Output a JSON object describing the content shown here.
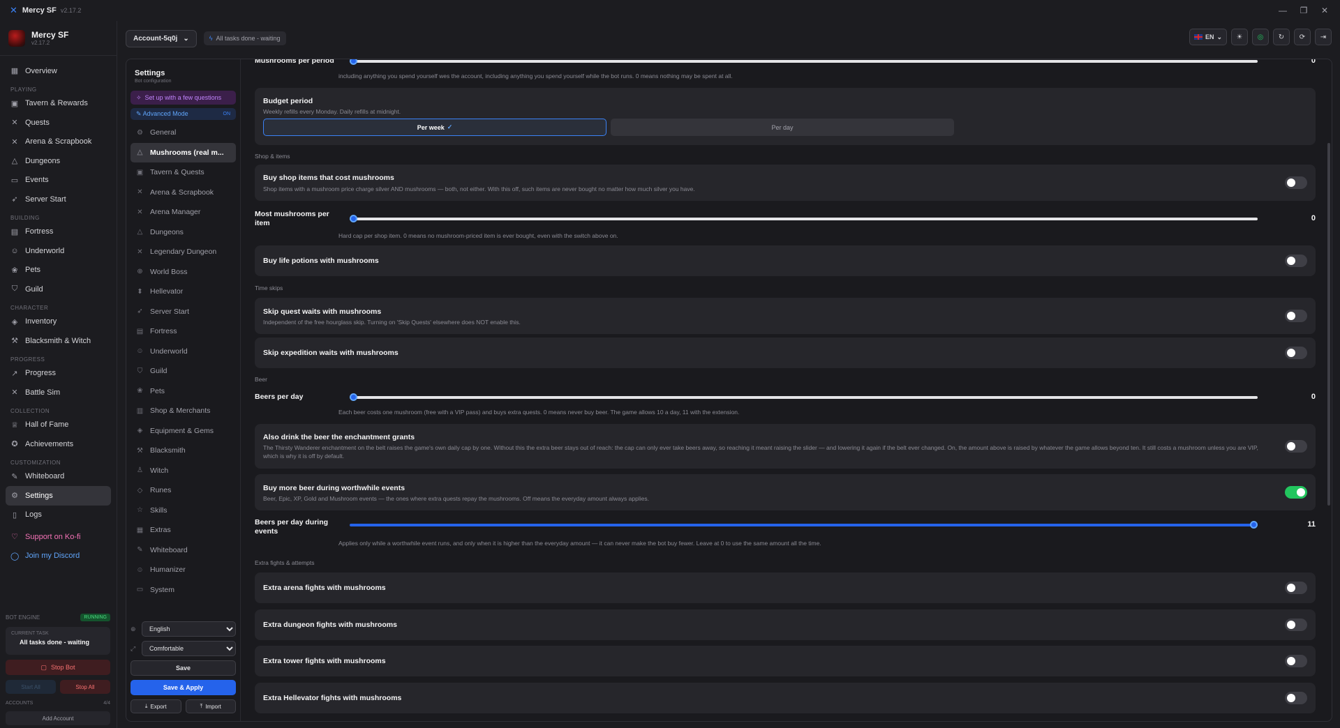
{
  "window": {
    "title": "Mercy SF",
    "version": "v2.17.2"
  },
  "brand": {
    "name": "Mercy SF",
    "version": "v2.17.2"
  },
  "sidebar": {
    "overview": "Overview",
    "sections": {
      "playing": "PLAYING",
      "building": "BUILDING",
      "character": "CHARACTER",
      "progress": "PROGRESS",
      "collection": "COLLECTION",
      "customization": "CUSTOMIZATION"
    },
    "playing": [
      "Tavern & Rewards",
      "Quests",
      "Arena & Scrapbook",
      "Dungeons",
      "Events",
      "Server Start"
    ],
    "building": [
      "Fortress",
      "Underworld",
      "Pets",
      "Guild"
    ],
    "character": [
      "Inventory",
      "Blacksmith & Witch"
    ],
    "progress": [
      "Progress",
      "Battle Sim"
    ],
    "collection": [
      "Hall of Fame",
      "Achievements"
    ],
    "customization": [
      "Whiteboard",
      "Settings",
      "Logs"
    ],
    "kofi": "Support on Ko-fi",
    "discord": "Join my Discord"
  },
  "engine": {
    "label": "BOT ENGINE",
    "status": "RUNNING",
    "current_task_label": "CURRENT TASK",
    "current_task": "All tasks done - waiting",
    "stop_bot": "Stop Bot",
    "start_all": "Start All",
    "stop_all": "Stop All",
    "accounts_label": "ACCOUNTS",
    "accounts_count": "4/4",
    "add_account": "Add Account"
  },
  "topbar": {
    "account": "Account-5q0j",
    "status": "All tasks done - waiting",
    "lang": "EN"
  },
  "settings_nav": {
    "title": "Settings",
    "subtitle": "Bot configuration",
    "setup": "Set up with a few questions",
    "advanced": "Advanced Mode",
    "advanced_state": "ON",
    "items": [
      "General",
      "Mushrooms (real m...",
      "Tavern & Quests",
      "Arena & Scrapbook",
      "Arena Manager",
      "Dungeons",
      "Legendary Dungeon",
      "World Boss",
      "Hellevator",
      "Server Start",
      "Fortress",
      "Underworld",
      "Guild",
      "Pets",
      "Shop & Merchants",
      "Equipment & Gems",
      "Blacksmith",
      "Witch",
      "Runes",
      "Skills",
      "Extras",
      "Whiteboard",
      "Humanizer",
      "System"
    ],
    "language": "English",
    "density": "Comfortable",
    "save": "Save",
    "save_apply": "Save & Apply",
    "export": "Export",
    "import": "Import"
  },
  "content": {
    "mushrooms_per_period": {
      "label": "Mushrooms per period",
      "value": "0",
      "fraction": 0,
      "help": "including anything you spend yourself wes the account, including anything you spend yourself while the bot runs. 0 means nothing may be spent at all."
    },
    "budget_period": {
      "title": "Budget period",
      "desc": "Weekly refills every Monday. Daily refills at midnight.",
      "options": [
        "Per week",
        "Per day"
      ],
      "selected": "Per week"
    },
    "sections": {
      "shop": "Shop & items",
      "time": "Time skips",
      "beer": "Beer",
      "extra": "Extra fights & attempts"
    },
    "buy_shop": {
      "title": "Buy shop items that cost mushrooms",
      "desc": "Shop items with a mushroom price charge silver AND mushrooms — both, not either. With this off, such items are never bought no matter how much silver you have.",
      "on": false
    },
    "most_per_item": {
      "label": "Most mushrooms per item",
      "value": "0",
      "fraction": 0,
      "help": "Hard cap per shop item. 0 means no mushroom-priced item is ever bought, even with the switch above on."
    },
    "life_potions": {
      "title": "Buy life potions with mushrooms",
      "on": false
    },
    "skip_quest": {
      "title": "Skip quest waits with mushrooms",
      "desc": "Independent of the free hourglass skip. Turning on 'Skip Quests' elsewhere does NOT enable this.",
      "on": false
    },
    "skip_expedition": {
      "title": "Skip expedition waits with mushrooms",
      "on": false
    },
    "beers_per_day": {
      "label": "Beers per day",
      "value": "0",
      "fraction": 0,
      "help": "Each beer costs one mushroom (free with a VIP pass) and buys extra quests. 0 means never buy beer. The game allows 10 a day, 11 with the extension."
    },
    "enchant_beer": {
      "title": "Also drink the beer the enchantment grants",
      "desc": "The Thirsty Wanderer enchantment on the belt raises the game's own daily cap by one. Without this the extra beer stays out of reach: the cap can only ever take beers away, so reaching it meant raising the slider — and lowering it again if the belt ever changed. On, the amount above is raised by whatever the game allows beyond ten. It still costs a mushroom unless you are VIP, which is why it is off by default.",
      "on": false
    },
    "buy_more_beer": {
      "title": "Buy more beer during worthwhile events",
      "desc": "Beer, Epic, XP, Gold and Mushroom events — the ones where extra quests repay the mushrooms. Off means the everyday amount always applies.",
      "on": true
    },
    "beers_events": {
      "label": "Beers per day during events",
      "value": "11",
      "fraction": 1,
      "help": "Applies only while a worthwhile event runs, and only when it is higher than the everyday amount — it can never make the bot buy fewer. Leave at 0 to use the same amount all the time."
    },
    "extra_arena": {
      "title": "Extra arena fights with mushrooms",
      "on": false
    },
    "extra_dungeon": {
      "title": "Extra dungeon fights with mushrooms",
      "on": false
    },
    "extra_tower": {
      "title": "Extra tower fights with mushrooms",
      "on": false
    },
    "extra_hellevator": {
      "title": "Extra Hellevator fights with mushrooms",
      "on": false
    }
  },
  "colors": {
    "accent": "#2563eb",
    "toggle_on": "#22c55e",
    "bg": "#1c1c20",
    "card": "#26262b"
  }
}
